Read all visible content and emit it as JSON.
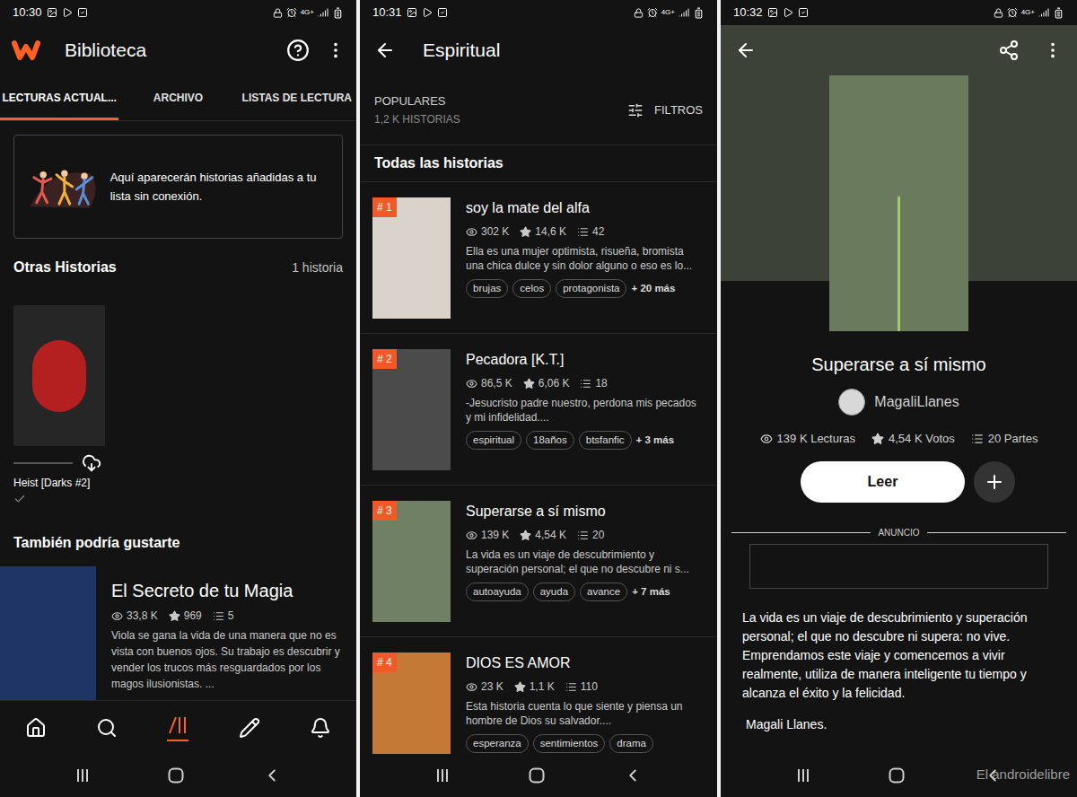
{
  "screens": [
    {
      "status_bar": {
        "time": "10:30",
        "network": "4G+"
      }
    },
    {
      "status_bar": {
        "time": "10:31",
        "network": "4G+"
      }
    },
    {
      "status_bar": {
        "time": "10:32",
        "network": "4G+"
      }
    }
  ],
  "library": {
    "title": "Biblioteca",
    "tabs": [
      {
        "label": "LECTURAS ACTUAL...",
        "selected": true
      },
      {
        "label": "ARCHIVO",
        "selected": false
      },
      {
        "label": "LISTAS DE LECTURA",
        "selected": false
      }
    ],
    "offline_banner": "Aquí aparecerán historias añadidas a tu lista sin conexión.",
    "other_stories": {
      "heading": "Otras Historias",
      "count": "1 historia",
      "items": [
        {
          "title": "Heist [Darks #2]",
          "level": 0,
          "synced": true
        }
      ]
    },
    "suggestions": {
      "heading": "También podría gustarte",
      "items": [
        {
          "title": "El Secreto de tu Magia",
          "views": "33,8 K",
          "votes": "969",
          "parts": "5",
          "description": "Viola se gana la vida de una manera que no es vista con buenos ojos. Su trabajo es descubrir y vender los trucos más resguardados por los magos ilusionistas. ..."
        }
      ]
    },
    "bottom_nav": [
      {
        "selected": false
      },
      {
        "selected": false
      },
      {
        "selected": true
      },
      {
        "selected": false
      },
      {
        "selected": false
      }
    ]
  },
  "category": {
    "title": "Espiritual",
    "sort": "POPULARES",
    "count": "1,2 K HISTORIAS",
    "filters": "FILTROS",
    "heading": "Todas las historias",
    "stories": [
      {
        "rank": "# 1",
        "title": "soy la mate del alfa",
        "views": "302 K",
        "votes": "14,6 K",
        "parts": "42",
        "description": "Ella es una mujer optimista, risueña, bromista una chica dulce y sin dolor alguno o eso es lo...",
        "tags": [
          "brujas",
          "celos",
          "protagonista"
        ],
        "more": "+ 20 más"
      },
      {
        "rank": "# 2",
        "title": "Pecadora [K.T.]",
        "views": "86,5 K",
        "votes": "6,06 K",
        "parts": "18",
        "description": "-Jesucristo padre nuestro, perdona mis pecados y mi infidelidad....",
        "tags": [
          "espiritual",
          "18años",
          "btsfanfic"
        ],
        "more": "+ 3 más"
      },
      {
        "rank": "# 3",
        "title": "Superarse a sí mismo",
        "views": "139 K",
        "votes": "4,54 K",
        "parts": "20",
        "description": "La vida es un viaje de descubrimiento y superación personal; el que no descubre ni s...",
        "tags": [
          "autoayuda",
          "ayuda",
          "avance"
        ],
        "more": "+ 7 más"
      },
      {
        "rank": "# 4",
        "title": "DIOS ES AMOR",
        "views": "23 K",
        "votes": "1,1 K",
        "parts": "110",
        "description": "Esta historia  cuenta lo que siente y piensa  un hombre de Dios su salvador....",
        "tags": [
          "esperanza",
          "sentimientos",
          "drama"
        ],
        "more": ""
      }
    ]
  },
  "story": {
    "title": "Superarse a sí mismo",
    "author": "MagaliLlanes",
    "reads": "139 K Lecturas",
    "votes": "4,54 K Votos",
    "parts": "20 Partes",
    "read_button": "Leer",
    "ad_label": "ANUNCIO",
    "description": "La vida es un viaje de descubrimiento y superación personal; el que no descubre ni supera: no vive. Emprendamos este viaje y comencemos a vivir realmente, utiliza de manera inteligente tu tiempo y alcanza el éxito y la felicidad.",
    "signature": "Magali Llanes."
  },
  "watermark": "El androidelibre"
}
